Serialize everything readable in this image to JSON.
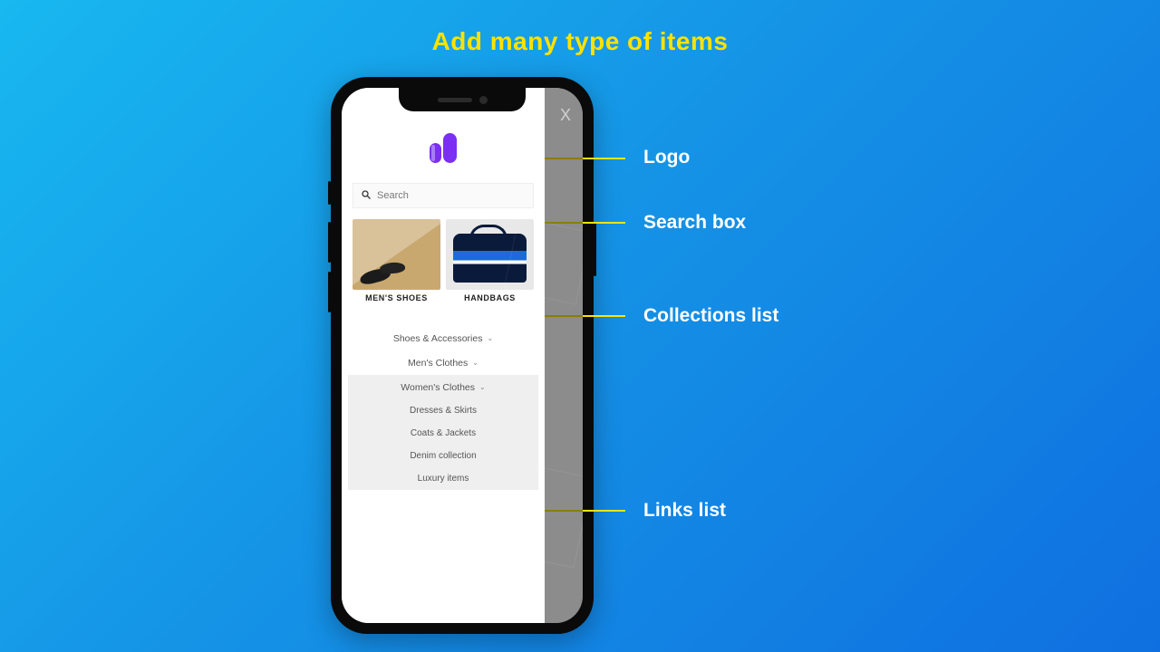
{
  "slide_title": "Add many type of items",
  "close_label": "X",
  "search": {
    "placeholder": "Search"
  },
  "collections": [
    {
      "id": "mens-shoes",
      "label": "MEN'S SHOES"
    },
    {
      "id": "handbags",
      "label": "HANDBAGS"
    }
  ],
  "links": {
    "items": [
      {
        "label": "Shoes & Accessories",
        "expanded": false
      },
      {
        "label": "Men's Clothes",
        "expanded": false
      },
      {
        "label": "Women's Clothes",
        "expanded": true,
        "children": [
          {
            "label": "Dresses & Skirts"
          },
          {
            "label": "Coats & Jackets"
          },
          {
            "label": "Denim collection"
          },
          {
            "label": "Luxury items"
          }
        ]
      }
    ]
  },
  "callouts": [
    {
      "label": "Logo"
    },
    {
      "label": "Search box"
    },
    {
      "label": "Collections list"
    },
    {
      "label": "Links list"
    }
  ]
}
